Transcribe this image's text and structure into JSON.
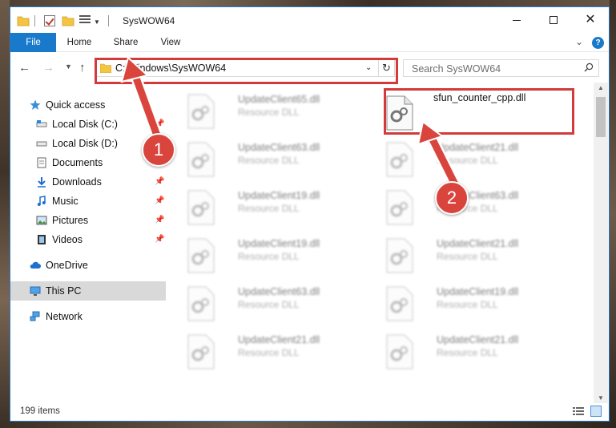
{
  "window": {
    "title": "SysWOW64"
  },
  "ribbon": {
    "tabs": [
      "File",
      "Home",
      "Share",
      "View"
    ]
  },
  "address": {
    "path": "C:\\Windows\\SysWOW64",
    "search_placeholder": "Search SysWOW64"
  },
  "sidebar": {
    "items": [
      {
        "label": "Quick access",
        "icon": "star-icon",
        "pinned": false
      },
      {
        "label": "Local Disk (C:)",
        "icon": "drive-icon",
        "pinned": true
      },
      {
        "label": "Local Disk (D:)",
        "icon": "drive-icon",
        "pinned": false
      },
      {
        "label": "Documents",
        "icon": "documents-icon",
        "pinned": true
      },
      {
        "label": "Downloads",
        "icon": "download-icon",
        "pinned": true
      },
      {
        "label": "Music",
        "icon": "music-icon",
        "pinned": true
      },
      {
        "label": "Pictures",
        "icon": "pictures-icon",
        "pinned": true
      },
      {
        "label": "Videos",
        "icon": "video-icon",
        "pinned": true
      },
      {
        "label": "OneDrive",
        "icon": "cloud-icon",
        "pinned": false
      },
      {
        "label": "This PC",
        "icon": "computer-icon",
        "pinned": false,
        "selected": true
      },
      {
        "label": "Network",
        "icon": "network-icon",
        "pinned": false
      }
    ]
  },
  "files": {
    "left": [
      {
        "name": "UpdateClient65.dll",
        "type": "Resource DLL"
      },
      {
        "name": "UpdateClient63.dll",
        "type": "Resource DLL"
      },
      {
        "name": "UpdateClient19.dll",
        "type": "Resource DLL"
      },
      {
        "name": "UpdateClient19.dll",
        "type": "Resource DLL"
      },
      {
        "name": "UpdateClient63.dll",
        "type": "Resource DLL"
      },
      {
        "name": "UpdateClient21.dll",
        "type": "Resource DLL"
      }
    ],
    "right": [
      {
        "name": "sfun_counter_cpp.dll",
        "type": "",
        "highlighted": true
      },
      {
        "name": "UpdateClient21.dll",
        "type": "Resource DLL"
      },
      {
        "name": "UpdateClient63.dll",
        "type": "Resource DLL"
      },
      {
        "name": "UpdateClient21.dll",
        "type": "Resource DLL"
      },
      {
        "name": "UpdateClient19.dll",
        "type": "Resource DLL"
      },
      {
        "name": "UpdateClient21.dll",
        "type": "Resource DLL"
      }
    ]
  },
  "status": {
    "item_count": "199 items"
  },
  "callouts": {
    "step1": "1",
    "step2": "2"
  },
  "colors": {
    "accent": "#1979ca",
    "highlight": "#d53a3a"
  }
}
